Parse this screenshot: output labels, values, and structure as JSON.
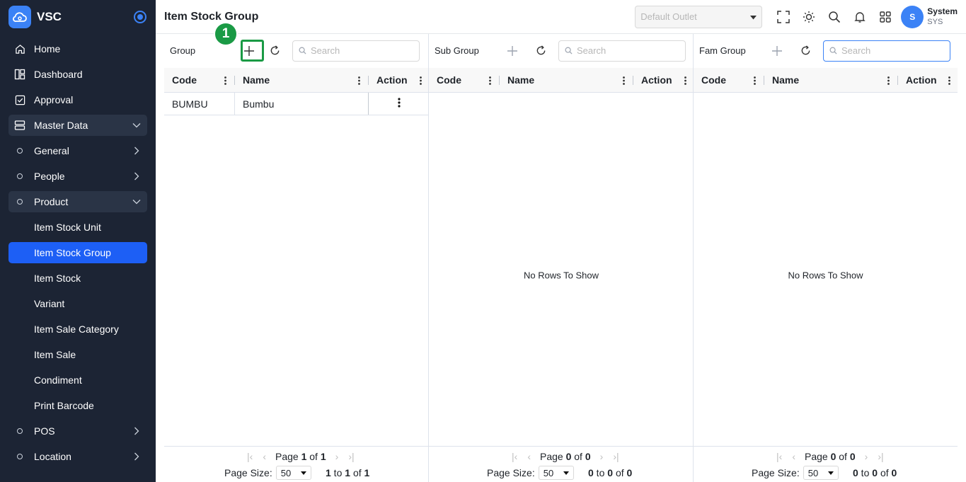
{
  "brand": {
    "name": "VSC"
  },
  "sidebar": {
    "items": [
      {
        "label": "Home",
        "icon": "home-icon"
      },
      {
        "label": "Dashboard",
        "icon": "dashboard-icon"
      },
      {
        "label": "Approval",
        "icon": "approval-icon"
      },
      {
        "label": "Master Data",
        "icon": "database-icon",
        "expanded": true
      },
      {
        "label": "General"
      },
      {
        "label": "People"
      },
      {
        "label": "Product",
        "expanded": true
      },
      {
        "label": "Item Stock Unit"
      },
      {
        "label": "Item Stock Group",
        "active": true
      },
      {
        "label": "Item Stock"
      },
      {
        "label": "Variant"
      },
      {
        "label": "Item Sale Category"
      },
      {
        "label": "Item Sale"
      },
      {
        "label": "Condiment"
      },
      {
        "label": "Print Barcode"
      },
      {
        "label": "POS"
      },
      {
        "label": "Location"
      }
    ]
  },
  "header": {
    "title": "Item Stock Group",
    "outlet_placeholder": "Default Outlet",
    "user": {
      "initial": "S",
      "name": "System",
      "code": "SYS"
    }
  },
  "annotation": {
    "step": "1"
  },
  "panels": [
    {
      "title": "Group",
      "search_placeholder": "Search",
      "columns": [
        "Code",
        "Name",
        "Action"
      ],
      "rows": [
        {
          "code": "BUMBU",
          "name": "Bumbu"
        }
      ],
      "empty_text": "",
      "pager": {
        "page": "1",
        "of": "1",
        "page_word": "Page",
        "of_word": "of"
      },
      "page_size_label": "Page Size:",
      "page_size": "50",
      "summary": {
        "from": "1",
        "to": "1",
        "total": "1"
      }
    },
    {
      "title": "Sub Group",
      "search_placeholder": "Search",
      "columns": [
        "Code",
        "Name",
        "Action"
      ],
      "rows": [],
      "empty_text": "No Rows To Show",
      "pager": {
        "page": "0",
        "of": "0",
        "page_word": "Page",
        "of_word": "of"
      },
      "page_size_label": "Page Size:",
      "page_size": "50",
      "summary": {
        "from": "0",
        "to": "0",
        "total": "0"
      }
    },
    {
      "title": "Fam Group",
      "search_placeholder": "Search",
      "columns": [
        "Code",
        "Name",
        "Action"
      ],
      "rows": [],
      "empty_text": "No Rows To Show",
      "pager": {
        "page": "0",
        "of": "0",
        "page_word": "Page",
        "of_word": "of"
      },
      "page_size_label": "Page Size:",
      "page_size": "50",
      "summary": {
        "from": "0",
        "to": "0",
        "total": "0"
      }
    }
  ],
  "colors": {
    "sidebar_bg": "#1c2434",
    "active": "#1d5ff5",
    "accent": "#3b82f6",
    "highlight": "#1a9a45"
  }
}
